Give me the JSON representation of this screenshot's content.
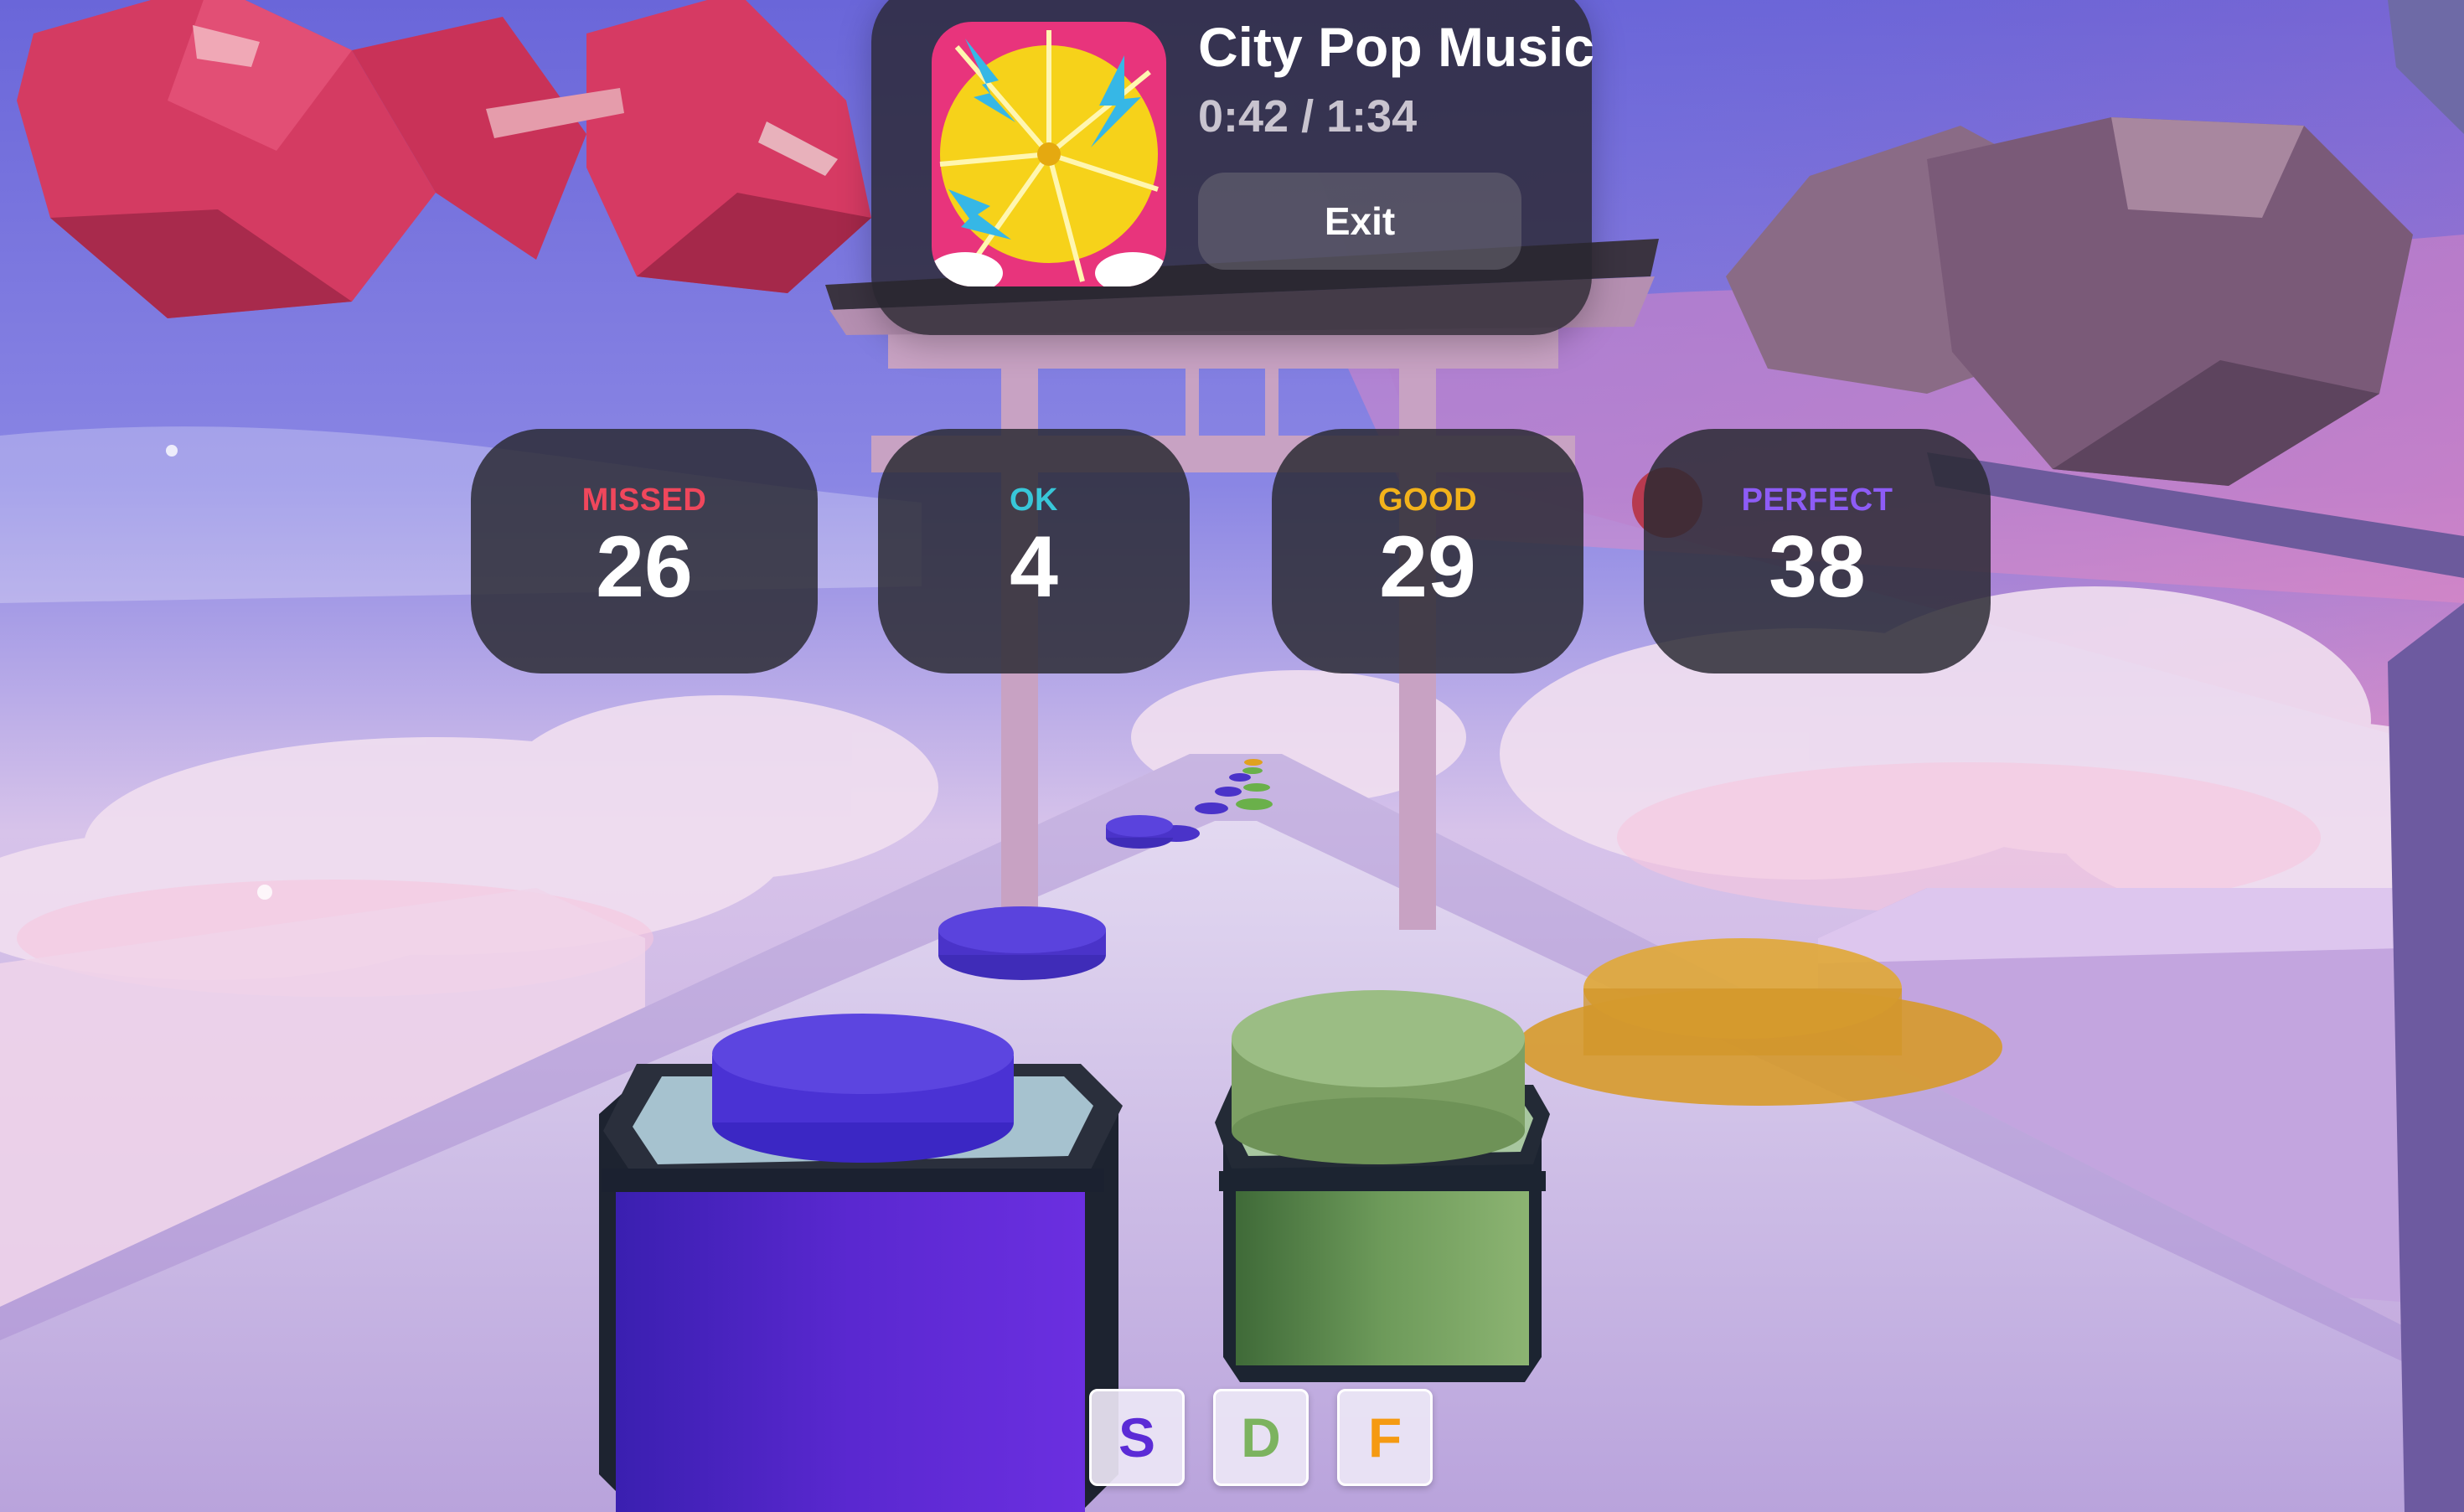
{
  "now_playing": {
    "title": "City Pop Music",
    "time": "0:42 / 1:34",
    "exit_label": "Exit"
  },
  "scores": [
    {
      "label": "MISSED",
      "value": "26"
    },
    {
      "label": "OK",
      "value": "4"
    },
    {
      "label": "GOOD",
      "value": "29"
    },
    {
      "label": "PERFECT",
      "value": "38"
    }
  ],
  "keys": [
    "S",
    "D",
    "F"
  ],
  "colors": {
    "missed": "#f0475c",
    "ok": "#38c7d8",
    "good": "#f2b21b",
    "perfect": "#8d5cf6",
    "drum_purple": "#5b2bd6",
    "drum_green": "#7cb35f",
    "note_orange": "#e0a11f"
  }
}
